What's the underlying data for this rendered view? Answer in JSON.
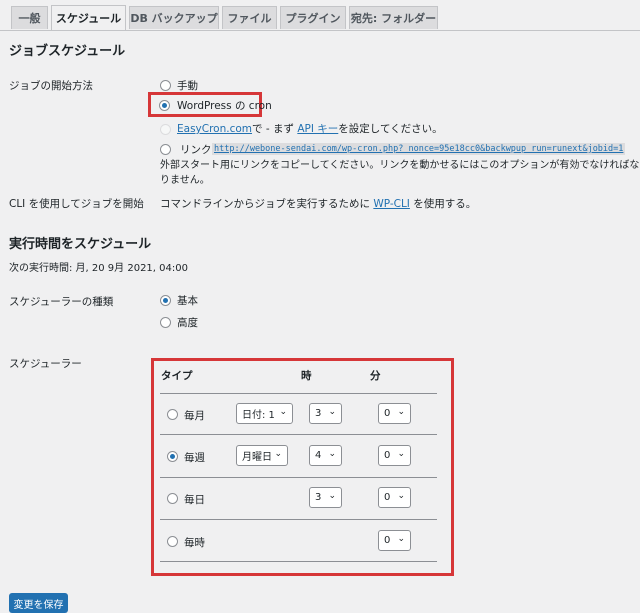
{
  "tabs": [
    {
      "label": "一般"
    },
    {
      "label": "スケジュール"
    },
    {
      "label": "DB バックアップ"
    },
    {
      "label": "ファイル"
    },
    {
      "label": "プラグイン"
    },
    {
      "label": "宛先: フォルダー"
    }
  ],
  "job_schedule": {
    "heading": "ジョブスケジュール",
    "start_label": "ジョブの開始方法",
    "options": {
      "manual": "手動",
      "wpcron": "WordPress の cron",
      "easycron_link": "EasyCron.com",
      "easycron_mid": "で - まず",
      "easycron_api": "API キー",
      "easycron_tail": "を設定してください。",
      "link": "リンク",
      "link_url": "http://webone-sendai.com/wp-cron.php?_nonce=95e18cc0&backwpup_run=runext&jobid=1",
      "link_note": "外部スタート用にリンクをコピーしてください。リンクを動かせるにはこのオプションが有効でなければなりません。"
    },
    "cli_label": "CLI を使用してジョブを開始",
    "cli_text_pre": "コマンドラインからジョブを実行するために",
    "cli_link": "WP-CLI",
    "cli_text_post": "を使用する。"
  },
  "run_schedule": {
    "heading": "実行時間をスケジュール",
    "next_run": "次の実行時間: 月, 20 9月 2021, 04:00",
    "type_label": "スケジューラーの種類",
    "type_basic": "基本",
    "type_advanced": "高度",
    "scheduler_label": "スケジューラー",
    "col_type": "タイプ",
    "col_hour": "時",
    "col_min": "分",
    "rows": [
      {
        "label": "毎月",
        "day": "日付: 1",
        "hour": "3",
        "min": "0"
      },
      {
        "label": "毎週",
        "day": "月曜日",
        "hour": "4",
        "min": "0"
      },
      {
        "label": "毎日",
        "hour": "3",
        "min": "0"
      },
      {
        "label": "毎時",
        "min": "0"
      }
    ]
  },
  "save_button": "変更を保存",
  "colors": {
    "accent": "#2271b1",
    "highlight": "#d63638"
  },
  "icons": {
    "select_arrow": "chevron-down-icon"
  }
}
